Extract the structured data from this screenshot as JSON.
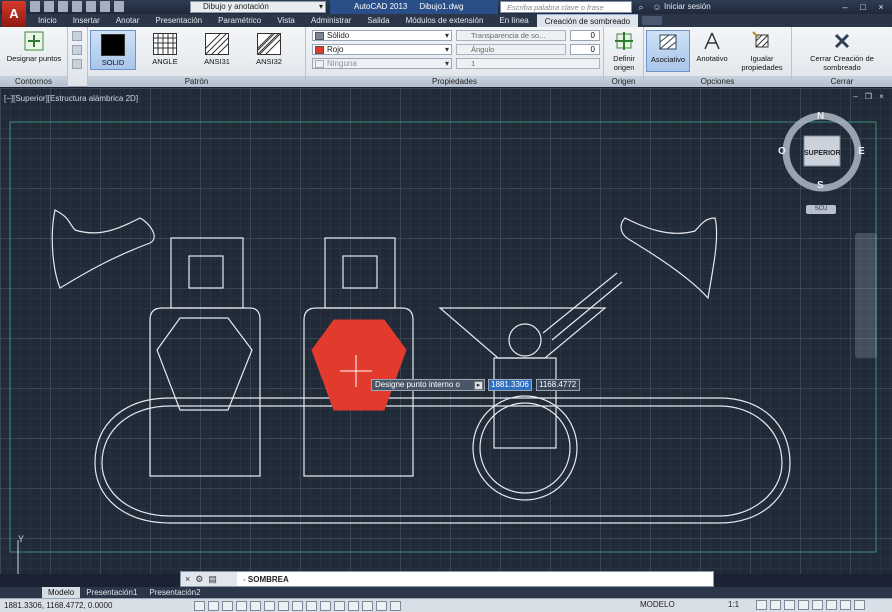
{
  "app": {
    "logo": "A",
    "workspace": "Dibujo y anotación",
    "name": "AutoCAD 2013",
    "file": "Dibujo1.dwg",
    "search_placeholder": "Escriba palabra clave o frase",
    "signin": "Iniciar sesión"
  },
  "tabs": [
    "Inicio",
    "Insertar",
    "Anotar",
    "Presentación",
    "Paramétrico",
    "Vista",
    "Administrar",
    "Salida",
    "Módulos de extensión",
    "En línea",
    "Creación de sombreado"
  ],
  "active_tab": "Creación de sombreado",
  "ribbon": {
    "contornos": {
      "title": "Contornos",
      "designar": "Designar puntos"
    },
    "patron": {
      "title": "Patrón",
      "items": [
        "SOLID",
        "ANGLE",
        "ANSI31",
        "ANSI32"
      ],
      "selected": "SOLID"
    },
    "propiedades": {
      "title": "Propiedades",
      "type": "Sólido",
      "color": "Rojo",
      "bg": "Ninguna",
      "transparency_label": "Transparencia de so...",
      "transparency_value": "0",
      "angle_label": "Ángulo",
      "angle_value": "0",
      "scale_value": "1",
      "color_hex": "#e23b2e"
    },
    "origen": {
      "title": "Origen",
      "definir": "Definir origen"
    },
    "opciones": {
      "title": "Opciones",
      "asociativo": "Asociativo",
      "anotativo": "Anotativo",
      "igualar": "Igualar propiedades"
    },
    "cerrar": {
      "title": "Cerrar",
      "label": "Cerrar Creación de sombreado"
    }
  },
  "viewport": {
    "label": "[−][Superior][Estructura alámbrica 2D]",
    "viewcube": {
      "top": "SUPERIOR",
      "n": "N",
      "s": "S",
      "e": "E",
      "w": "O"
    },
    "wcs": "SCU",
    "axis_y": "Y",
    "tooltip": {
      "prompt": "Designe punto interno o",
      "x": "1881.3306",
      "y": "1168.4772"
    }
  },
  "command": {
    "text": "SOMBREA"
  },
  "layout_tabs": [
    "Modelo",
    "Presentación1",
    "Presentación2"
  ],
  "status": {
    "coords": "1881.3306, 1168.4772, 0.0000",
    "model": "MODELO",
    "scale": "1:1"
  }
}
